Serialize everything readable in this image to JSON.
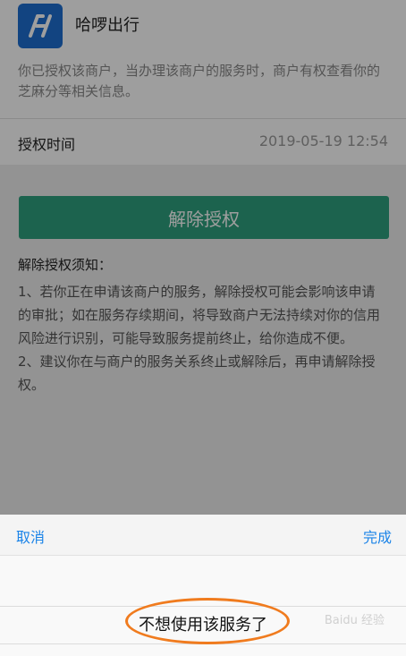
{
  "merchant": {
    "name": "哈啰出行",
    "logo_icon": "hellobike-logo-icon",
    "description": "你已授权该商户，当办理该商户的服务时，商户有权查看你的芝麻分等相关信息。"
  },
  "auth_time": {
    "label": "授权时间",
    "value": "2019-05-19 12:54"
  },
  "revoke_button": {
    "label": "解除授权",
    "color": "#2ea17e"
  },
  "notice": {
    "title": "解除授权须知：",
    "body": "1、若你正在申请该商户的服务，解除授权可能会影响该申请的审批；如在服务存续期间，将导致商户无法持续对你的信用风险进行识别，可能导致服务提前终止，给你造成不便。\n2、建议你在与商户的服务关系终止或解除后，再申请解除授权。"
  },
  "picker_sheet": {
    "cancel_label": "取消",
    "done_label": "完成",
    "selected_option": "不想使用该服务了",
    "accent_color": "#1a83e8"
  },
  "annotation": {
    "color": "#f07b1e"
  },
  "watermark": "Baidu 经验"
}
